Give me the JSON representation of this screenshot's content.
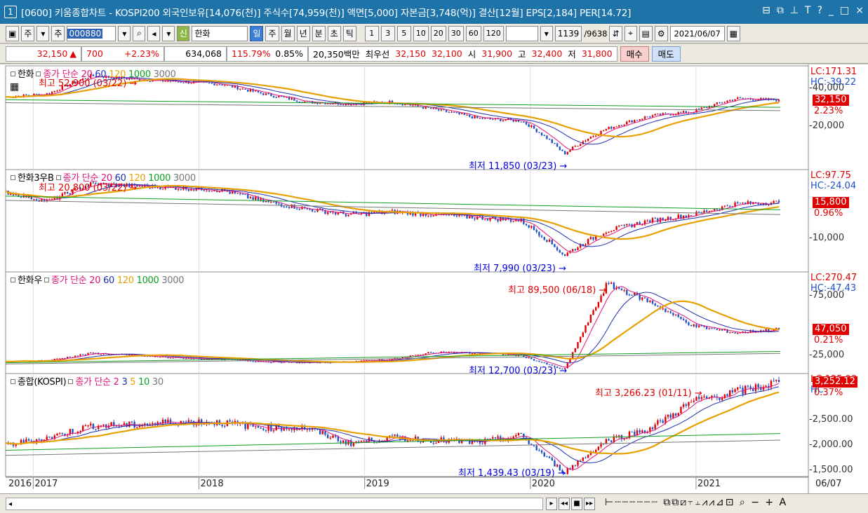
{
  "window": {
    "number": "1",
    "title": "[0600] 키움종합차트 - KOSPI200 외국인보유[14,076(천)] 주식수[74,959(천)] 액면[5,000] 자본금[3,748(억)] 결산[12월] EPS[2,184] PER[14.72]",
    "ctrl_icons": [
      "restore-icon",
      "tile-icon",
      "pin-icon",
      "text-icon",
      "help-icon",
      "minimize-icon",
      "maximize-icon",
      "close-icon"
    ],
    "ctrl_glyphs": [
      "⊟",
      "⧉",
      "⊥",
      "T",
      "?",
      "_",
      "□",
      "×"
    ]
  },
  "toolbar": {
    "mode_stock": "주",
    "add": "추",
    "code": "000880",
    "name_badge": "신",
    "name": "한화",
    "periods": [
      "일",
      "주",
      "월",
      "년"
    ],
    "units": [
      "분",
      "초",
      "틱"
    ],
    "intervals": [
      "1",
      "3",
      "5",
      "10",
      "20",
      "30",
      "60",
      "120"
    ],
    "count": "1139",
    "total": "/9638",
    "date": "2021/06/07"
  },
  "infobar": {
    "price": "32,150",
    "arrow": "▲",
    "change": "700",
    "rate": "+2.23%",
    "volume": "634,068",
    "vol_ratio": "115.79%",
    "turnover": "0.85%",
    "amount": "20,350백만",
    "best_label": "최우선",
    "best_ask": "32,150",
    "best_bid": "32,100",
    "open_label": "시",
    "open": "31,900",
    "high_label": "고",
    "high": "32,400",
    "low_label": "저",
    "low": "31,800",
    "buy": "매수",
    "sell": "매도"
  },
  "panels": [
    {
      "name": "한화",
      "legend_prefix": "종가 단순",
      "periods": [
        "20",
        "60",
        "120",
        "1000",
        "3000"
      ],
      "max_label": "최고 52,900 (03/22)",
      "min_label": "최저 11,850 (03/23)",
      "lc": "LC:171.31",
      "hc": "HC:-39.22",
      "scale": [
        "40,000",
        "20,000"
      ],
      "current": "32,150",
      "pct": "2.23%"
    },
    {
      "name": "한화3우B",
      "legend_prefix": "종가 단순",
      "periods": [
        "20",
        "60",
        "120",
        "1000",
        "3000"
      ],
      "max_label": "최고 20,800 (03/22)",
      "min_label": "최저 7,990 (03/23)",
      "lc": "LC:97.75",
      "hc": "HC:-24.04",
      "scale": [
        "10,000"
      ],
      "current": "15,800",
      "pct": "0.96%"
    },
    {
      "name": "한화우",
      "legend_prefix": "종가 단순",
      "periods": [
        "20",
        "60",
        "120",
        "1000",
        "3000"
      ],
      "max_label": "최고 89,500 (06/18)",
      "min_label": "최저 12,700 (03/23)",
      "lc": "LC:270.47",
      "hc": "HC:-47.43",
      "scale": [
        "75,000",
        "25,000"
      ],
      "current": "47,050",
      "pct": "0.21%"
    },
    {
      "name": "종합(KOSPI)",
      "legend_prefix": "종가 단순",
      "periods": [
        "2",
        "3",
        "5",
        "10",
        "30"
      ],
      "max_label": "최고 3,266.23 (01/11)",
      "min_label": "최저 1,439.43 (03/19)",
      "lc": "LC:125.93",
      "hc": "HC",
      "scale": [
        "2,500.00",
        "2,000.00",
        "1,500.00"
      ],
      "current": "3,252.12",
      "pct": "0.37%"
    }
  ],
  "xaxis": [
    "2016",
    "2017",
    "2018",
    "2019",
    "2020",
    "2021",
    "06/07"
  ],
  "colors": {
    "ma20": "#e0147a",
    "ma60": "#1e2fb0",
    "ma120": "#e8a000",
    "ma1000": "#10a020",
    "ma3000": "#777777",
    "up": "#e00000",
    "down": "#1e50c8",
    "title_bg": "#1e73a8"
  },
  "chart_data": [
    {
      "type": "line",
      "title": "한화",
      "x": [
        "2016-10",
        "2017-03",
        "2017-06",
        "2017-09",
        "2017-12",
        "2018-03",
        "2018-06",
        "2018-09",
        "2018-12",
        "2019-03",
        "2019-06",
        "2019-09",
        "2019-12",
        "2020-03",
        "2020-06",
        "2020-09",
        "2020-12",
        "2021-03",
        "2021-06"
      ],
      "series": [
        {
          "values": [
            34000,
            36000,
            50000,
            47000,
            45000,
            43000,
            36000,
            31000,
            30000,
            31000,
            27000,
            23000,
            22000,
            12000,
            19000,
            24000,
            26000,
            33000,
            32150
          ]
        }
      ]
    },
    {
      "type": "line",
      "title": "한화3우B",
      "x": [
        "2016-10",
        "2017-03",
        "2017-06",
        "2017-09",
        "2017-12",
        "2018-03",
        "2018-06",
        "2018-09",
        "2018-12",
        "2019-03",
        "2019-06",
        "2019-09",
        "2019-12",
        "2020-03",
        "2020-06",
        "2020-09",
        "2020-12",
        "2021-03",
        "2021-06"
      ],
      "series": [
        {
          "values": [
            18000,
            16000,
            20000,
            19500,
            19000,
            18500,
            16000,
            14500,
            13500,
            14000,
            13500,
            13000,
            12500,
            8000,
            11000,
            12500,
            13500,
            15500,
            15800
          ]
        }
      ]
    },
    {
      "type": "line",
      "title": "한화우",
      "x": [
        "2016-10",
        "2017-03",
        "2017-06",
        "2017-09",
        "2017-12",
        "2018-03",
        "2018-06",
        "2018-09",
        "2018-12",
        "2019-03",
        "2019-06",
        "2019-09",
        "2019-12",
        "2020-03",
        "2020-06",
        "2020-09",
        "2020-12",
        "2021-03",
        "2021-06"
      ],
      "series": [
        {
          "values": [
            20000,
            21000,
            27000,
            25000,
            23000,
            22000,
            20000,
            19000,
            20000,
            22000,
            28000,
            27000,
            25000,
            13000,
            85000,
            70000,
            50000,
            44000,
            47050
          ]
        }
      ]
    },
    {
      "type": "line",
      "title": "종합(KOSPI)",
      "x": [
        "2016-10",
        "2017-03",
        "2017-06",
        "2017-09",
        "2017-12",
        "2018-03",
        "2018-06",
        "2018-09",
        "2018-12",
        "2019-03",
        "2019-06",
        "2019-09",
        "2019-12",
        "2020-03",
        "2020-06",
        "2020-09",
        "2020-12",
        "2021-03",
        "2021-06"
      ],
      "series": [
        {
          "values": [
            2000,
            2150,
            2390,
            2400,
            2470,
            2450,
            2350,
            2340,
            2040,
            2150,
            2100,
            2050,
            2190,
            1460,
            2100,
            2330,
            2870,
            3050,
            3252.12
          ]
        }
      ]
    }
  ]
}
